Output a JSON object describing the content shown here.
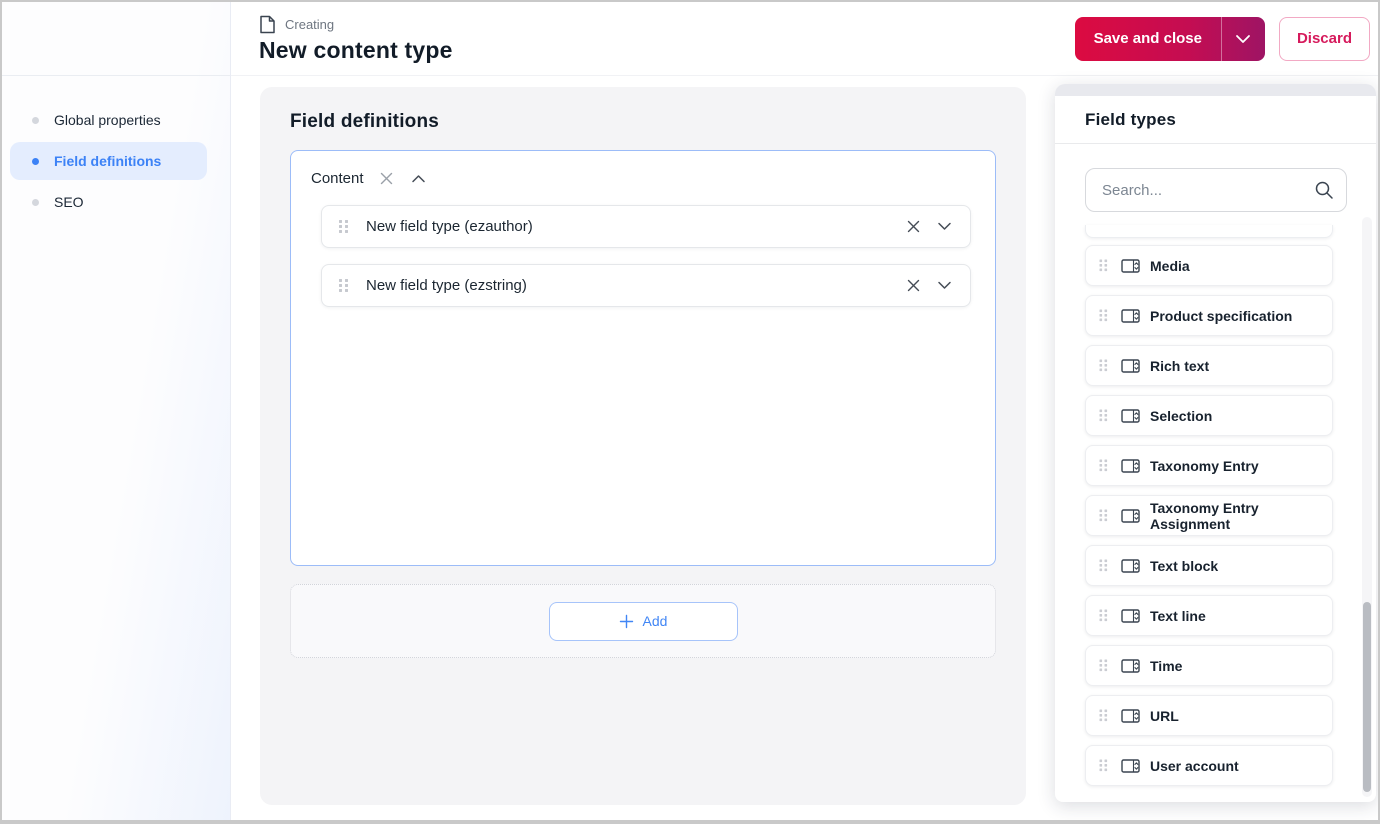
{
  "header": {
    "kicker": "Creating",
    "title": "New content type",
    "save_label": "Save and close",
    "discard_label": "Discard"
  },
  "sidebar": {
    "items": [
      {
        "label": "Global properties",
        "active": false
      },
      {
        "label": "Field definitions",
        "active": true
      },
      {
        "label": "SEO",
        "active": false
      }
    ]
  },
  "field_definitions": {
    "section_title": "Field definitions",
    "group_name": "Content",
    "fields": [
      {
        "label": "New field type (ezauthor)"
      },
      {
        "label": "New field type (ezstring)"
      }
    ],
    "add_label": "Add"
  },
  "field_types": {
    "title": "Field types",
    "search_placeholder": "Search...",
    "items": [
      {
        "label": "Media"
      },
      {
        "label": "Product specification"
      },
      {
        "label": "Rich text"
      },
      {
        "label": "Selection"
      },
      {
        "label": "Taxonomy Entry"
      },
      {
        "label": "Taxonomy Entry Assignment"
      },
      {
        "label": "Text block"
      },
      {
        "label": "Text line"
      },
      {
        "label": "Time"
      },
      {
        "label": "URL"
      },
      {
        "label": "User account"
      }
    ]
  },
  "colors": {
    "primary_gradient_start": "#dc0b41",
    "primary_gradient_end": "#9e1464",
    "discard_text": "#d61a5c",
    "discard_border": "#f2a9c4",
    "active_blue": "#3c82f6",
    "active_blue_bg": "#e4edfe",
    "group_border_blue": "#9cbcf8",
    "container_gray": "#f4f4f6",
    "panel_strip_gray": "#e8e9ee"
  }
}
